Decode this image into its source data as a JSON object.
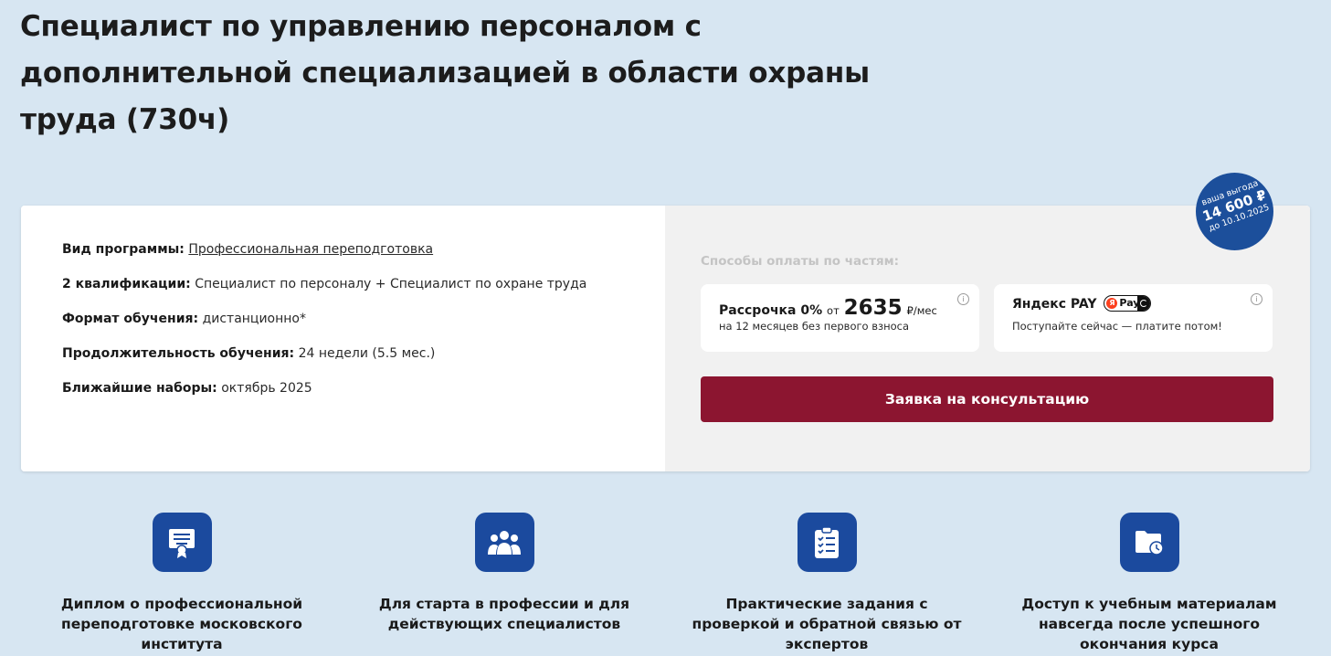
{
  "page": {
    "title": "Специалист по управлению персоналом с дополнительной специализацией в области охраны труда (730ч)"
  },
  "program": {
    "type_label": "Вид программы:",
    "type_value": "Профессиональная переподготовка",
    "qual_label": "2 квалификации:",
    "qual_value": "Специалист по персоналу + Специалист по охране труда",
    "format_label": "Формат обучения:",
    "format_value": "дистанционно*",
    "duration_label": "Продолжительность обучения:",
    "duration_value": "24 недели (5.5 мес.)",
    "intake_label": "Ближайшие наборы:",
    "intake_value": "октябрь 2025"
  },
  "payment": {
    "title": "Способы оплаты по частям:",
    "installment": {
      "name": "Рассрочка 0%",
      "from": "от",
      "amount": "2635",
      "unit": "₽/мес",
      "note": "на 12 месяцев без первого взноса",
      "info_icon": "i"
    },
    "yandex": {
      "name": "Яндекс PAY",
      "badge_y": "Я",
      "badge_pay": "Pay",
      "note": "Поступайте сейчас — платите потом!",
      "info_icon": "i"
    },
    "cta_label": "Заявка на консультацию"
  },
  "benefit": {
    "line1": "ваша выгода",
    "amount": "14 600 ₽",
    "until": "до 10.10.2025"
  },
  "features": [
    {
      "icon": "diploma-icon",
      "text": "Диплом о профессиональной переподготовке московского института"
    },
    {
      "icon": "group-icon",
      "text": "Для старта в профессии и для действующих специалистов"
    },
    {
      "icon": "checklist-icon",
      "text": "Практические задания с проверкой и обратной связью от экспертов"
    },
    {
      "icon": "folder-clock-icon",
      "text": "Доступ к учебным материалам навсегда после успешного окончания курса"
    }
  ],
  "colors": {
    "background": "#d7e6f2",
    "accent_blue": "#1b4a9e",
    "cta": "#8c1530"
  }
}
